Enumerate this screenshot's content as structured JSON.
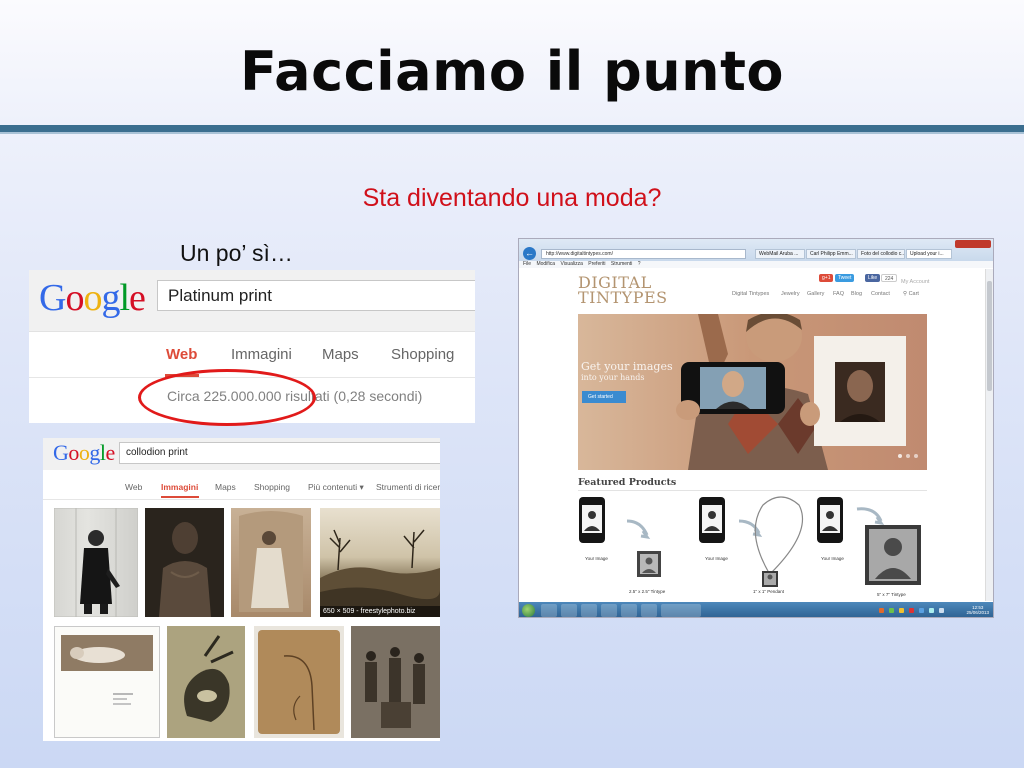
{
  "slide": {
    "title": "Facciamo il punto",
    "subtitle": "Sta diventando una moda?",
    "caption": "Un po’ sì…"
  },
  "colors": {
    "title_rule": "#3b6e8f",
    "subtitle": "#d0101a",
    "google_active": "#dd4b39",
    "highlight_ellipse": "#e11a1a"
  },
  "google_results": {
    "logo": [
      "G",
      "o",
      "o",
      "g",
      "l",
      "e"
    ],
    "query": "Platinum print",
    "tabs": [
      "Web",
      "Immagini",
      "Maps",
      "Shopping"
    ],
    "active_tab": "Web",
    "results_count": "Circa 225.000.000 risultati (0,28 secondi)"
  },
  "google_images": {
    "logo": [
      "G",
      "o",
      "o",
      "g",
      "l",
      "e"
    ],
    "query": "collodion print",
    "tabs": [
      "Web",
      "Immagini",
      "Maps",
      "Shopping",
      "Più contenuti ▾",
      "Strumenti di ricerca"
    ],
    "active_tab": "Immagini",
    "image_caption": "650 × 509 - freestylephoto.biz"
  },
  "browser": {
    "url": "http://www.digitaltintypes.com/",
    "tabs": [
      "WebMail Aruba ...",
      "Carl Philipp Emm...",
      "Foto del collodio c...",
      "Upload your i..."
    ],
    "menu": [
      "File",
      "Modifica",
      "Visualizza",
      "Preferiti",
      "Strumenti",
      "?"
    ],
    "site": {
      "logo_line1": "DIGITAL",
      "logo_line2": "TINTYPES",
      "nav": [
        "Digital Tintypes",
        "Jewelry",
        "Gallery",
        "FAQ",
        "Blog",
        "Contact",
        "Cart"
      ],
      "account": "My Account",
      "social": [
        "g+1",
        "Tweet",
        "Like",
        "224"
      ],
      "hero_line1": "Get your images",
      "hero_line2": "into your hands",
      "hero_button": "Get started",
      "featured_title": "Featured Products",
      "product_labels": [
        "Your Image",
        "2.5\" x 2.5\" Tintype",
        "Your Image",
        "1\" x 1\" Pendant",
        "Your Image",
        "5\" x 7\" Tintype"
      ]
    },
    "clock_time": "12:53",
    "clock_date": "25/06/2013"
  }
}
